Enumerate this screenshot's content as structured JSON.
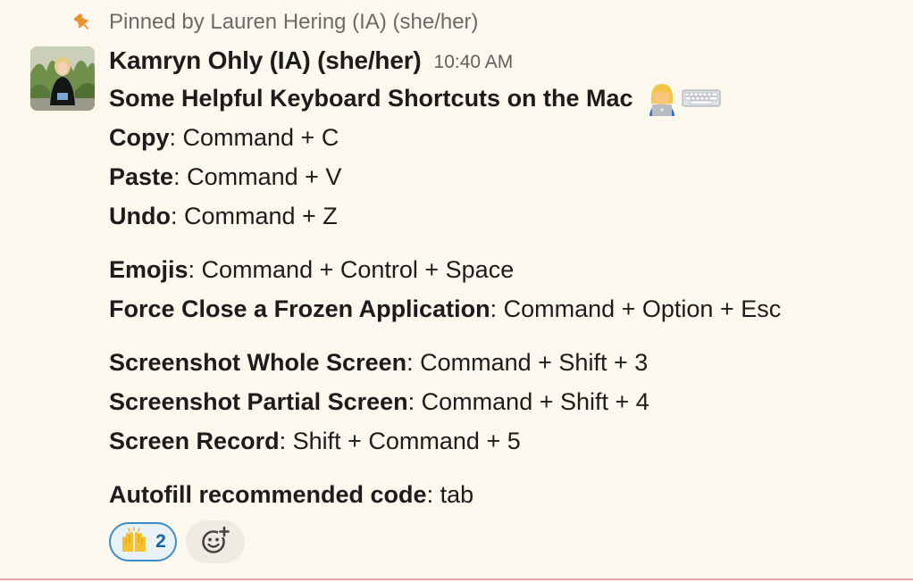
{
  "pinned": {
    "text": "Pinned by Lauren Hering (IA) (she/her)"
  },
  "message": {
    "author": "Kamryn Ohly (IA) (she/her)",
    "timestamp": "10:40 AM",
    "title": "Some Helpful Keyboard Shortcuts on the Mac",
    "title_emojis": [
      "technologist-icon",
      "keyboard-icon"
    ],
    "group1": [
      {
        "label": "Copy",
        "value": ": Command + C"
      },
      {
        "label": "Paste",
        "value": ": Command + V"
      },
      {
        "label": "Undo",
        "value": ": Command + Z"
      }
    ],
    "group2": [
      {
        "label": "Emojis",
        "value": ": Command + Control + Space"
      },
      {
        "label": "Force Close a Frozen Application",
        "value": ": Command + Option + Esc"
      }
    ],
    "group3": [
      {
        "label": "Screenshot Whole Screen",
        "value": ": Command + Shift + 3"
      },
      {
        "label": "Screenshot Partial Screen",
        "value": ": Command + Shift + 4"
      },
      {
        "label": "Screen Record",
        "value": ": Shift + Command + 5"
      }
    ],
    "group4": [
      {
        "label": "Autofill recommended code",
        "value": ": tab"
      }
    ]
  },
  "reactions": [
    {
      "emoji": "raised-hands-icon",
      "count": "2",
      "selected": true
    }
  ],
  "colors": {
    "background": "#fdf8ed",
    "reaction_border": "#3b8dc4",
    "reaction_count": "#1264a3",
    "pin": "#e8912d",
    "bottom_divider": "#e8a4b6"
  }
}
